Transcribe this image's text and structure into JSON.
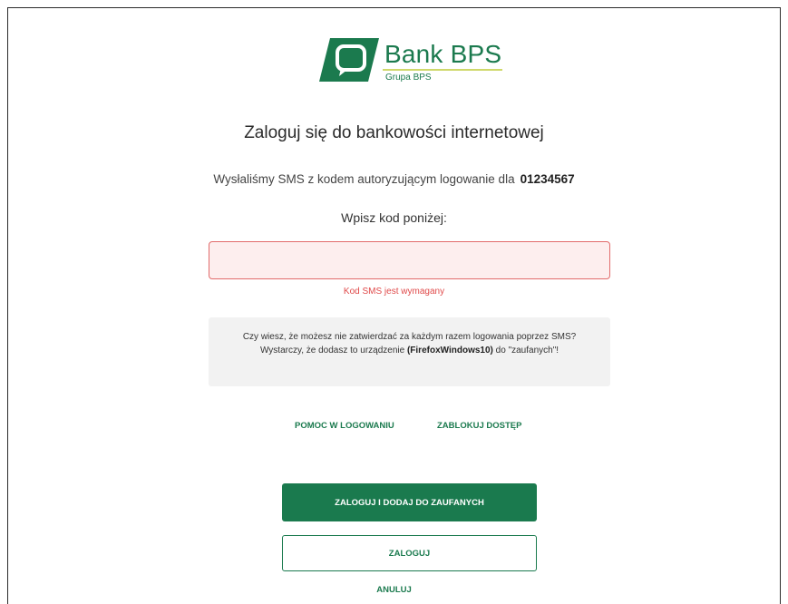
{
  "brand": {
    "name": "Bank BPS",
    "subtitle": "Grupa BPS",
    "colors": {
      "primary": "#1a7a4e",
      "accent_line": "#cfd86a",
      "error": "#e04a4a",
      "input_error_bg": "#fdeeee"
    }
  },
  "page": {
    "title": "Zaloguj się do bankowości internetowej",
    "sms_text": "Wysłaliśmy SMS z kodem autoryzującym logowanie dla",
    "client_number": "01234567",
    "enter_code_label": "Wpisz kod poniżej:"
  },
  "code_input": {
    "value": "",
    "placeholder": ""
  },
  "error_message": "Kod SMS jest wymagany",
  "info": {
    "text_before": "Czy wiesz, że możesz nie zatwierdzać za każdym razem logowania poprzez SMS? Wystarczy, że dodasz to urządzenie",
    "device": "(FirefoxWindows10)",
    "text_after": "do \"zaufanych\"!"
  },
  "links": {
    "help": "POMOC W LOGOWANIU",
    "block": "ZABLOKUJ DOSTĘP"
  },
  "buttons": {
    "login_and_trust": "ZALOGUJ I DODAJ DO ZAUFANYCH",
    "login": "ZALOGUJ",
    "cancel": "ANULUJ"
  }
}
